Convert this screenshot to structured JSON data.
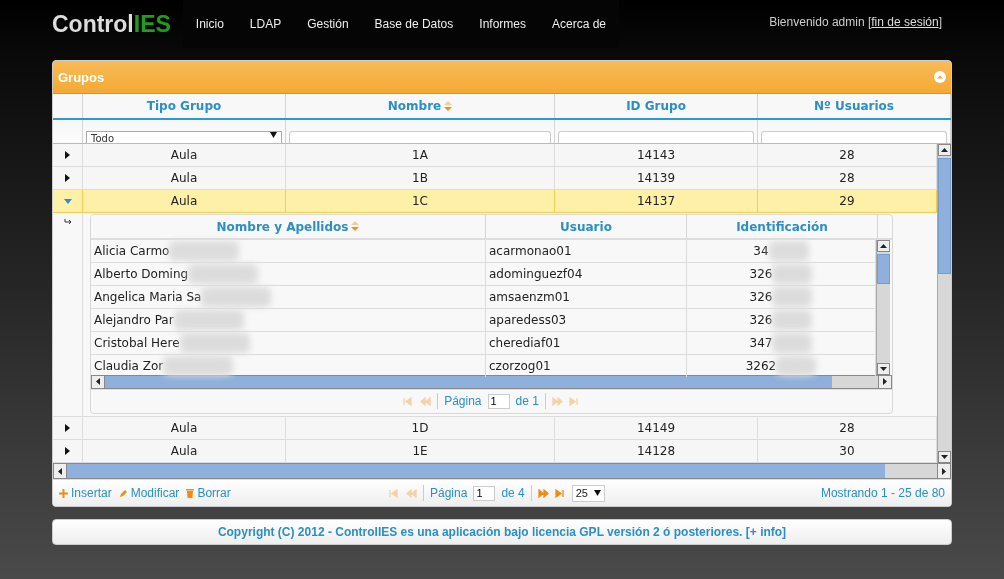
{
  "brand": {
    "text": "Control",
    "accent": "IES"
  },
  "nav": [
    {
      "label": "Inicio"
    },
    {
      "label": "LDAP"
    },
    {
      "label": "Gestión"
    },
    {
      "label": "Base de Datos"
    },
    {
      "label": "Informes"
    },
    {
      "label": "Acerca de"
    }
  ],
  "welcome": {
    "text": "Bienvenido admin [",
    "link": "fin de sesión",
    "end": "]"
  },
  "panel": {
    "title": "Grupos"
  },
  "columns": [
    {
      "label": "Tipo Grupo",
      "sorted": false
    },
    {
      "label": "Nombre",
      "sorted": true
    },
    {
      "label": "ID Grupo",
      "sorted": false
    },
    {
      "label": "Nº Usuarios",
      "sorted": false
    }
  ],
  "filters": [
    {
      "kind": "select",
      "value": "Todo"
    },
    {
      "kind": "text"
    },
    {
      "kind": "text"
    },
    {
      "kind": "text"
    }
  ],
  "rows": [
    {
      "tipo": "Aula",
      "nombre": "1A",
      "id": "14143",
      "usuarios": "28",
      "expanded": false,
      "selected": false
    },
    {
      "tipo": "Aula",
      "nombre": "1B",
      "id": "14139",
      "usuarios": "28",
      "expanded": false,
      "selected": false
    },
    {
      "tipo": "Aula",
      "nombre": "1C",
      "id": "14137",
      "usuarios": "29",
      "expanded": true,
      "selected": true,
      "detail": {
        "columns": [
          {
            "label": "Nombre y Apellidos",
            "sorted": true
          },
          {
            "label": "Usuario",
            "sorted": false
          },
          {
            "label": "Identificación",
            "sorted": false
          }
        ],
        "rows": [
          {
            "nombre": "Alicia Carmo",
            "usuario": "acarmonao01",
            "ident": "34",
            "blurred": true
          },
          {
            "nombre": "Alberto Doming",
            "usuario": "adominguezf04",
            "ident": "326",
            "blurred": true
          },
          {
            "nombre": "Angelica Maria Sa",
            "usuario": "amsaenzm01",
            "ident": "326",
            "blurred": true
          },
          {
            "nombre": "Alejandro Par",
            "usuario": "aparedess03",
            "ident": "326",
            "blurred": true
          },
          {
            "nombre": "Cristobal Here",
            "usuario": "cherediaf01",
            "ident": "347",
            "blurred": true
          },
          {
            "nombre": "Claudia Zor",
            "usuario": "czorzog01",
            "ident": "3262",
            "blurred": true
          }
        ],
        "pager": {
          "nav": [
            {
              "kind": "first",
              "disabled": true
            },
            {
              "kind": "prev",
              "disabled": true
            },
            {
              "kind": "next",
              "disabled": true
            },
            {
              "kind": "last",
              "disabled": true
            }
          ],
          "page_label": "Página",
          "page": "1",
          "of": "de 1"
        }
      }
    },
    {
      "tipo": "Aula",
      "nombre": "1D",
      "id": "14149",
      "usuarios": "28",
      "expanded": false,
      "selected": false
    },
    {
      "tipo": "Aula",
      "nombre": "1E",
      "id": "14128",
      "usuarios": "30",
      "expanded": false,
      "selected": false
    }
  ],
  "pager": {
    "actions": [
      {
        "kind": "add",
        "label": "Insertar"
      },
      {
        "kind": "edit",
        "label": "Modificar"
      },
      {
        "kind": "delete",
        "label": "Borrar"
      }
    ],
    "nav": [
      {
        "kind": "first",
        "disabled": true
      },
      {
        "kind": "prev",
        "disabled": true
      },
      {
        "kind": "next",
        "disabled": false
      },
      {
        "kind": "last",
        "disabled": false
      }
    ],
    "page_label": "Página",
    "page": "1",
    "of": "de 4",
    "page_size": "25",
    "summary": "Mostrando 1 - 25 de 80"
  },
  "footer": "Copyright (C) 2012 - ControlIES es una aplicación bajo licencia GPL versión 2 ó posteriores. [+ info]"
}
